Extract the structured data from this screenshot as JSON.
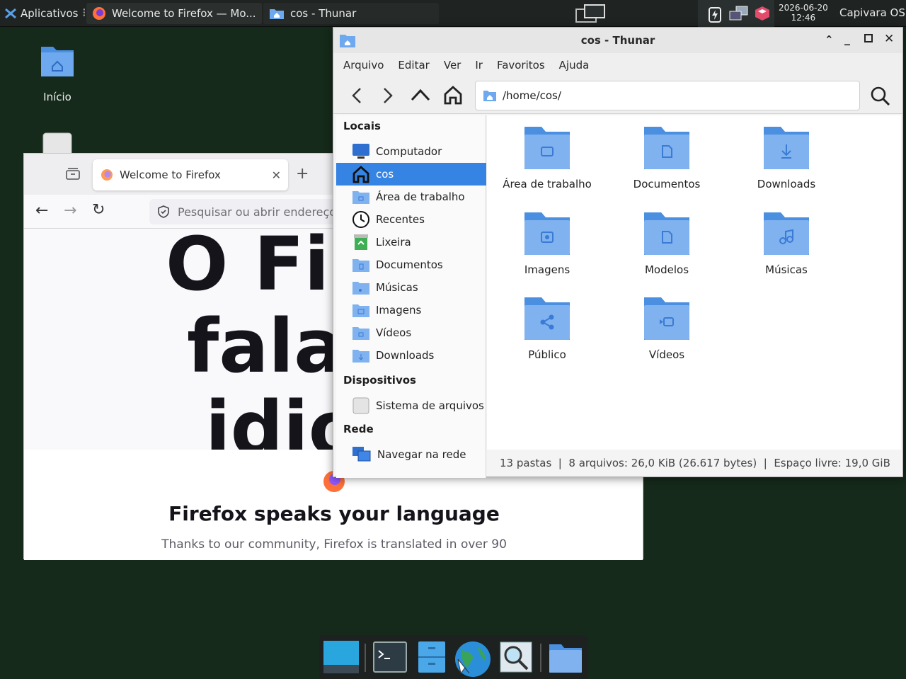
{
  "panel": {
    "apps_label": "Aplicativos",
    "task1_label": "Welcome to Firefox — Mo...",
    "task2_label": "cos - Thunar",
    "date": "2026-06-20",
    "time": "12:46",
    "os_label": "Capivara OS"
  },
  "desktop": {
    "home_label": "Início"
  },
  "firefox": {
    "tab_title": "Welcome to Firefox",
    "url_placeholder": "Pesquisar ou abrir endereço",
    "hero_line1": "O Fir",
    "hero_line2": "fala",
    "hero_line3": "idio",
    "heading": "Firefox speaks your language",
    "subheading": "Thanks to our community, Firefox is translated in over 90"
  },
  "thunar": {
    "title": "cos - Thunar",
    "menu": [
      "Arquivo",
      "Editar",
      "Ver",
      "Ir",
      "Favoritos",
      "Ajuda"
    ],
    "location": "/home/cos/",
    "sidebar": {
      "locais_heading": "Locais",
      "locais": [
        "Computador",
        "cos",
        "Área de trabalho",
        "Recentes",
        "Lixeira",
        "Documentos",
        "Músicas",
        "Imagens",
        "Vídeos",
        "Downloads"
      ],
      "dispositivos_heading": "Dispositivos",
      "dispositivos": [
        "Sistema de arquivos"
      ],
      "rede_heading": "Rede",
      "rede": [
        "Navegar na rede"
      ]
    },
    "folders": [
      "Área de trabalho",
      "Documentos",
      "Downloads",
      "Imagens",
      "Modelos",
      "Músicas",
      "Público",
      "Vídeos"
    ],
    "status": "13 pastas  |  8 arquivos: 26,0 KiB (26.617 bytes)  |  Espaço livre: 19,0 GiB"
  },
  "colors": {
    "selection": "#3584e4",
    "folder": "#6ea8ee",
    "desktop_bg": "#152a1a"
  }
}
